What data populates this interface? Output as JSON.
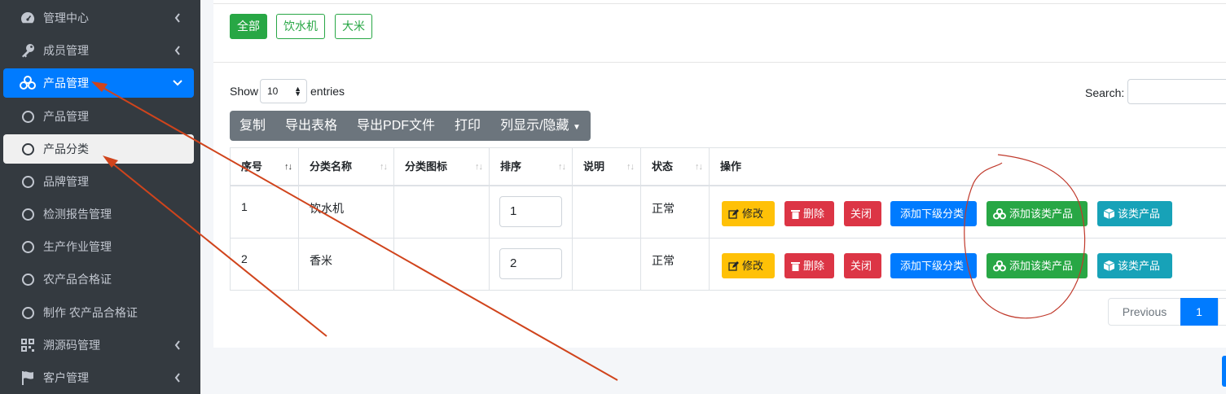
{
  "sidebar": {
    "items": [
      {
        "label": "管理中心",
        "icon": "tachometer-icon"
      },
      {
        "label": "成员管理",
        "icon": "key-icon"
      },
      {
        "label": "产品管理",
        "icon": "cubes-icon"
      },
      {
        "label": "产品管理",
        "icon": "circle-icon"
      },
      {
        "label": "产品分类",
        "icon": "circle-icon"
      },
      {
        "label": "品牌管理",
        "icon": "circle-icon"
      },
      {
        "label": "检测报告管理",
        "icon": "circle-icon"
      },
      {
        "label": "生产作业管理",
        "icon": "circle-icon"
      },
      {
        "label": "农产品合格证",
        "icon": "circle-icon"
      },
      {
        "label": "制作 农产品合格证",
        "icon": "circle-icon"
      },
      {
        "label": "溯源码管理",
        "icon": "qrcode-icon"
      },
      {
        "label": "客户管理",
        "icon": "flag-icon"
      }
    ]
  },
  "filters": {
    "all": "全部",
    "f1": "饮水机",
    "f2": "大米"
  },
  "datatable": {
    "show": "Show",
    "page_length": "10",
    "entries": "entries",
    "search": "Search:"
  },
  "export_buttons": {
    "copy": "复制",
    "excel": "导出表格",
    "pdf": "导出PDF文件",
    "print": "打印",
    "colvis": "列显示/隐藏"
  },
  "table": {
    "headers": [
      "序号",
      "分类名称",
      "分类图标",
      "排序",
      "说明",
      "状态",
      "操作"
    ],
    "rows": [
      {
        "id": "1",
        "name": "饮水机",
        "icon": "",
        "order": "1",
        "desc": "",
        "status": "正常"
      },
      {
        "id": "2",
        "name": "香米",
        "icon": "",
        "order": "2",
        "desc": "",
        "status": "正常"
      }
    ],
    "actions": {
      "edit": "修改",
      "delete": "删除",
      "close": "关闭",
      "add_sub": "添加下级分类",
      "add_product": "添加该类产品",
      "view_products": "该类产品"
    }
  },
  "pagination": {
    "previous": "Previous",
    "current": "1"
  },
  "colors": {
    "primary": "#007bff",
    "success": "#28a745",
    "danger": "#dc3545",
    "warning": "#ffc107",
    "info": "#17a2b8",
    "sidebar": "#343a40",
    "annotation": "#d0441c"
  }
}
